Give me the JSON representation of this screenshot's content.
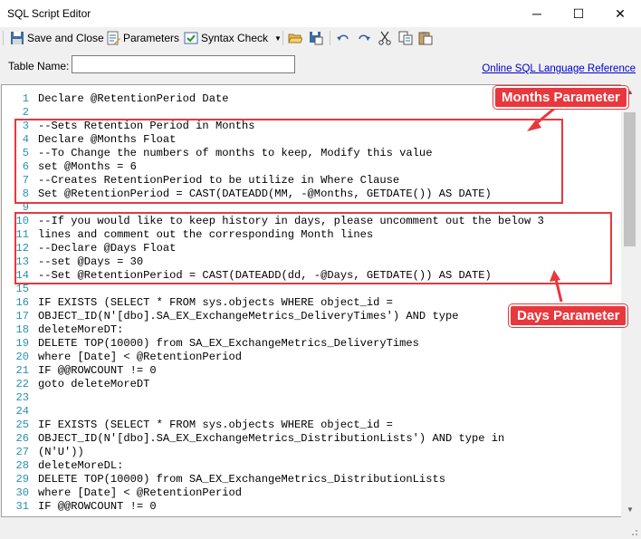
{
  "window": {
    "title": "SQL Script Editor",
    "minimize": "─",
    "maximize": "☐",
    "close": "✕"
  },
  "toolbar": {
    "save_close": "Save and Close",
    "parameters": "Parameters",
    "syntax_check": "Syntax Check",
    "syntax_dropdown": "▼"
  },
  "table_name": {
    "label": "Table Name:",
    "value": ""
  },
  "reference_link": "Online SQL Language Reference",
  "code_lines": [
    {
      "n": "1",
      "text": "Declare @RetentionPeriod Date"
    },
    {
      "n": "2",
      "text": ""
    },
    {
      "n": "3",
      "text": "--Sets Retention Period in Months"
    },
    {
      "n": "4",
      "text": "Declare @Months Float"
    },
    {
      "n": "5",
      "text": "--To Change the numbers of months to keep, Modify this value"
    },
    {
      "n": "6",
      "text": "set @Months = 6"
    },
    {
      "n": "7",
      "text": "--Creates RetentionPeriod to be utilize in Where Clause"
    },
    {
      "n": "8",
      "text": "Set @RetentionPeriod = CAST(DATEADD(MM, -@Months, GETDATE()) AS DATE)"
    },
    {
      "n": "9",
      "text": ""
    },
    {
      "n": "10",
      "text": "--If you would like to keep history in days, please uncomment out the below 3"
    },
    {
      "n": "11",
      "text": "lines and comment out the corresponding Month lines"
    },
    {
      "n": "12",
      "text": "--Declare @Days Float"
    },
    {
      "n": "13",
      "text": "--set @Days = 30"
    },
    {
      "n": "14",
      "text": "--Set @RetentionPeriod = CAST(DATEADD(dd, -@Days, GETDATE()) AS DATE)"
    },
    {
      "n": "15",
      "text": ""
    },
    {
      "n": "16",
      "text": "IF EXISTS (SELECT * FROM sys.objects WHERE object_id ="
    },
    {
      "n": "17",
      "text": "OBJECT_ID(N'[dbo].SA_EX_ExchangeMetrics_DeliveryTimes') AND type"
    },
    {
      "n": "18",
      "text": "deleteMoreDT:"
    },
    {
      "n": "19",
      "text": "DELETE TOP(10000) from SA_EX_ExchangeMetrics_DeliveryTimes"
    },
    {
      "n": "20",
      "text": "where [Date] < @RetentionPeriod"
    },
    {
      "n": "21",
      "text": "IF @@ROWCOUNT != 0"
    },
    {
      "n": "22",
      "text": "goto deleteMoreDT"
    },
    {
      "n": "23",
      "text": ""
    },
    {
      "n": "24",
      "text": ""
    },
    {
      "n": "25",
      "text": "IF EXISTS (SELECT * FROM sys.objects WHERE object_id ="
    },
    {
      "n": "26",
      "text": "OBJECT_ID(N'[dbo].SA_EX_ExchangeMetrics_DistributionLists') AND type in"
    },
    {
      "n": "27",
      "text": "(N'U'))"
    },
    {
      "n": "28",
      "text": "deleteMoreDL:"
    },
    {
      "n": "29",
      "text": "DELETE TOP(10000) from SA_EX_ExchangeMetrics_DistributionLists"
    },
    {
      "n": "30",
      "text": "where [Date] < @RetentionPeriod"
    },
    {
      "n": "31",
      "text": "IF @@ROWCOUNT != 0"
    }
  ],
  "annotations": {
    "months": "Months Parameter",
    "days": "Days Parameter",
    "color": "#e8383d"
  }
}
